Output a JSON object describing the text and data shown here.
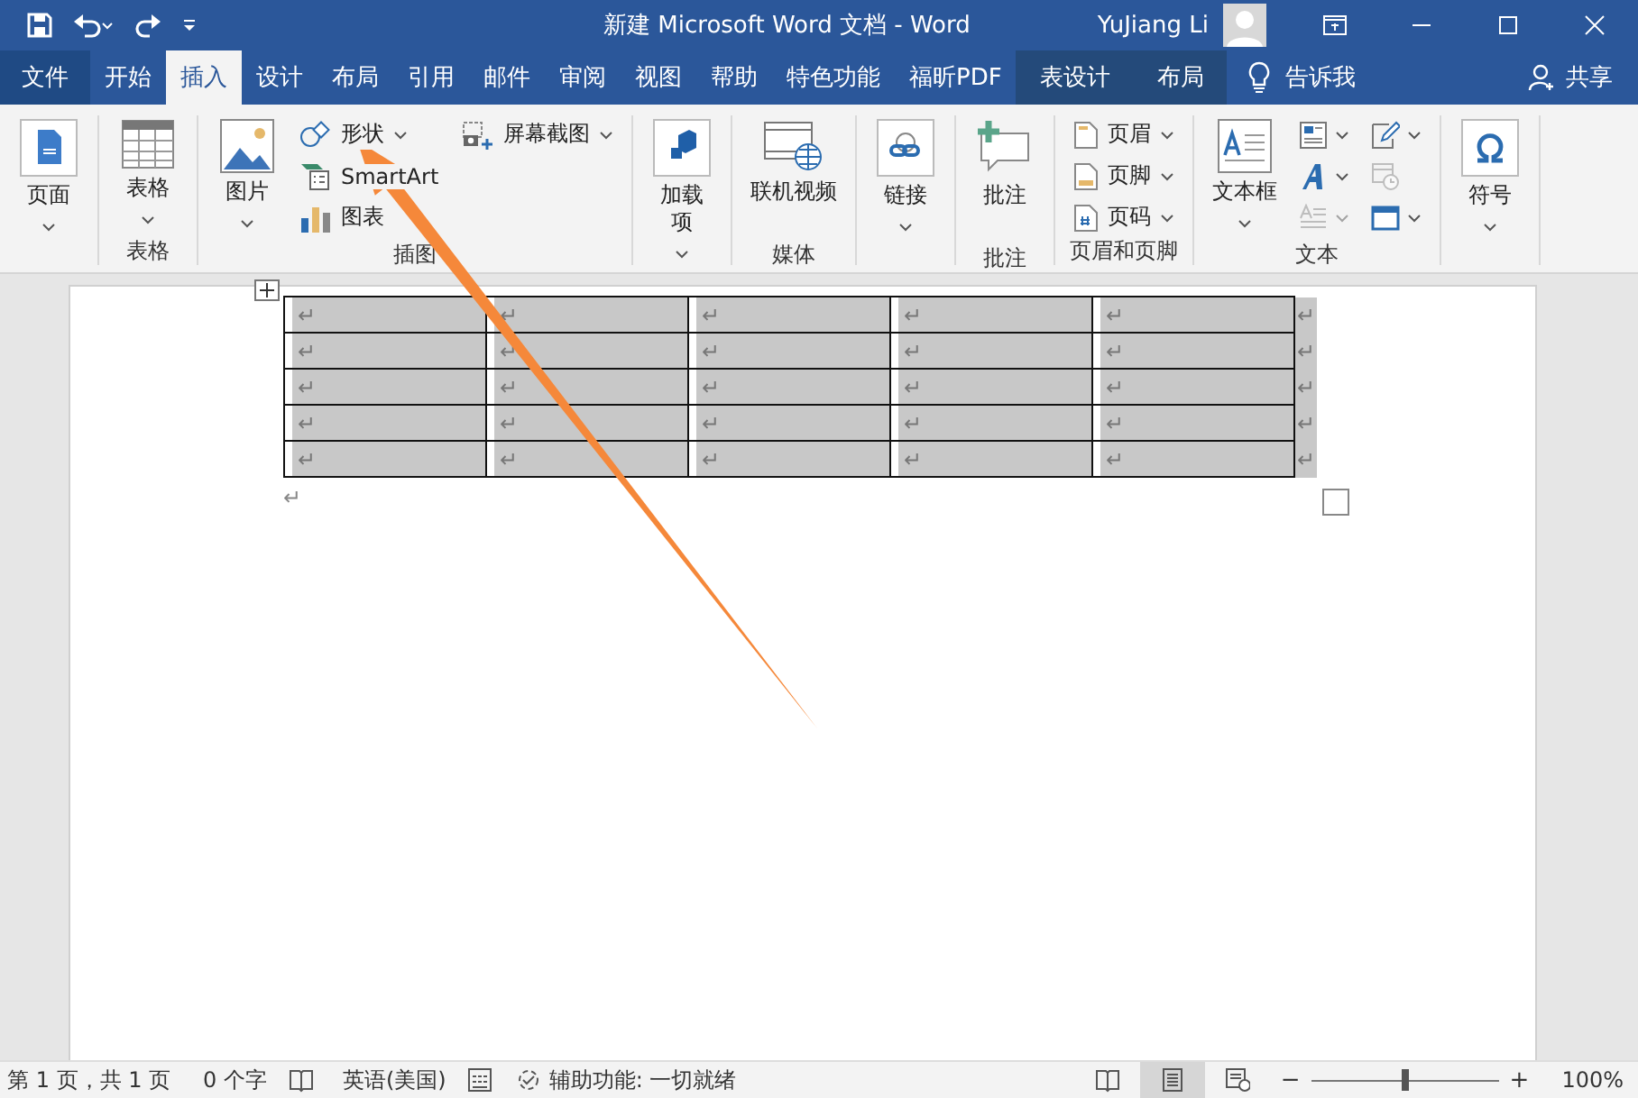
{
  "title_bar": {
    "title": "新建 Microsoft Word 文档  -  Word",
    "user": "YuJiang Li"
  },
  "tabs": [
    {
      "label": "文件",
      "kind": "file",
      "selected": false
    },
    {
      "label": "开始",
      "kind": "normal",
      "selected": false
    },
    {
      "label": "插入",
      "kind": "normal",
      "selected": true
    },
    {
      "label": "设计",
      "kind": "normal",
      "selected": false
    },
    {
      "label": "布局",
      "kind": "normal",
      "selected": false
    },
    {
      "label": "引用",
      "kind": "normal",
      "selected": false
    },
    {
      "label": "邮件",
      "kind": "normal",
      "selected": false
    },
    {
      "label": "审阅",
      "kind": "normal",
      "selected": false
    },
    {
      "label": "视图",
      "kind": "normal",
      "selected": false
    },
    {
      "label": "帮助",
      "kind": "normal",
      "selected": false
    },
    {
      "label": "特色功能",
      "kind": "normal",
      "selected": false
    },
    {
      "label": "福昕PDF",
      "kind": "normal",
      "selected": false
    },
    {
      "label": "表设计",
      "kind": "context",
      "selected": false
    },
    {
      "label": "布局",
      "kind": "context",
      "selected": false
    }
  ],
  "tell_me": {
    "label": "告诉我"
  },
  "share": {
    "label": "共享"
  },
  "ribbon": {
    "groups": [
      {
        "items": [
          {
            "kind": "large",
            "label": "页面",
            "dropdown": true
          }
        ]
      },
      {
        "label": "表格",
        "items": [
          {
            "kind": "large",
            "label": "表格",
            "dropdown": true
          }
        ]
      },
      {
        "label": "插图",
        "items": [
          {
            "kind": "large",
            "label": "图片",
            "dropdown": true
          },
          {
            "kind": "stack",
            "items": [
              {
                "label": "形状",
                "dropdown": true
              },
              {
                "label": "SmartArt",
                "dropdown": false
              },
              {
                "label": "图表",
                "dropdown": false
              }
            ]
          },
          {
            "kind": "stack",
            "items": [
              {
                "label": "屏幕截图",
                "dropdown": true
              }
            ]
          }
        ]
      },
      {
        "items": [
          {
            "kind": "large",
            "label": "加载项",
            "dropdown": true
          }
        ]
      },
      {
        "label": "媒体",
        "items": [
          {
            "kind": "large",
            "label": "联机视频",
            "dropdown": false
          }
        ]
      },
      {
        "items": [
          {
            "kind": "large",
            "label": "链接",
            "dropdown": true
          }
        ]
      },
      {
        "label": "批注",
        "items": [
          {
            "kind": "large",
            "label": "批注",
            "dropdown": false
          }
        ]
      },
      {
        "label": "页眉和页脚",
        "items": [
          {
            "kind": "stack",
            "items": [
              {
                "label": "页眉",
                "dropdown": true
              },
              {
                "label": "页脚",
                "dropdown": true
              },
              {
                "label": "页码",
                "dropdown": true
              }
            ]
          }
        ]
      },
      {
        "label": "文本",
        "items": [
          {
            "kind": "large",
            "label": "文本框",
            "dropdown": true
          },
          {
            "kind": "icons",
            "items": [
              {
                "dropdown": true,
                "disabled": false
              },
              {
                "dropdown": true,
                "disabled": false
              },
              {
                "dropdown": true,
                "disabled": true
              }
            ]
          },
          {
            "kind": "icons",
            "items": [
              {
                "dropdown": true,
                "disabled": false
              },
              {
                "dropdown": false,
                "disabled": true
              },
              {
                "dropdown": true,
                "disabled": false
              }
            ]
          }
        ]
      },
      {
        "items": [
          {
            "kind": "large",
            "label": "符号",
            "dropdown": true
          }
        ]
      }
    ]
  },
  "document": {
    "table": {
      "rows": [
        {
          "cells": [
            "↵",
            "↵",
            "↵",
            "↵",
            "↵"
          ],
          "end_mark": "↵"
        },
        {
          "cells": [
            "↵",
            "↵",
            "↵",
            "↵",
            "↵"
          ],
          "end_mark": "↵"
        },
        {
          "cells": [
            "↵",
            "↵",
            "↵",
            "↵",
            "↵"
          ],
          "end_mark": "↵"
        },
        {
          "cells": [
            "↵",
            "↵",
            "↵",
            "↵",
            "↵"
          ],
          "end_mark": "↵"
        },
        {
          "cells": [
            "↵",
            "↵",
            "↵",
            "↵",
            "↵"
          ],
          "end_mark": "↵"
        }
      ]
    },
    "after_table": "↵"
  },
  "status_bar": {
    "page": "第 1 页，共 1 页",
    "words": "0 个字",
    "language": "英语(美国)",
    "accessibility": "辅助功能: 一切就绪",
    "views": [
      {
        "selected": false
      },
      {
        "selected": true
      },
      {
        "selected": false
      }
    ],
    "zoom_minus": "−",
    "zoom_plus": "+",
    "zoom": {
      "level": 0.5
    },
    "zoom_percent": "100%"
  }
}
